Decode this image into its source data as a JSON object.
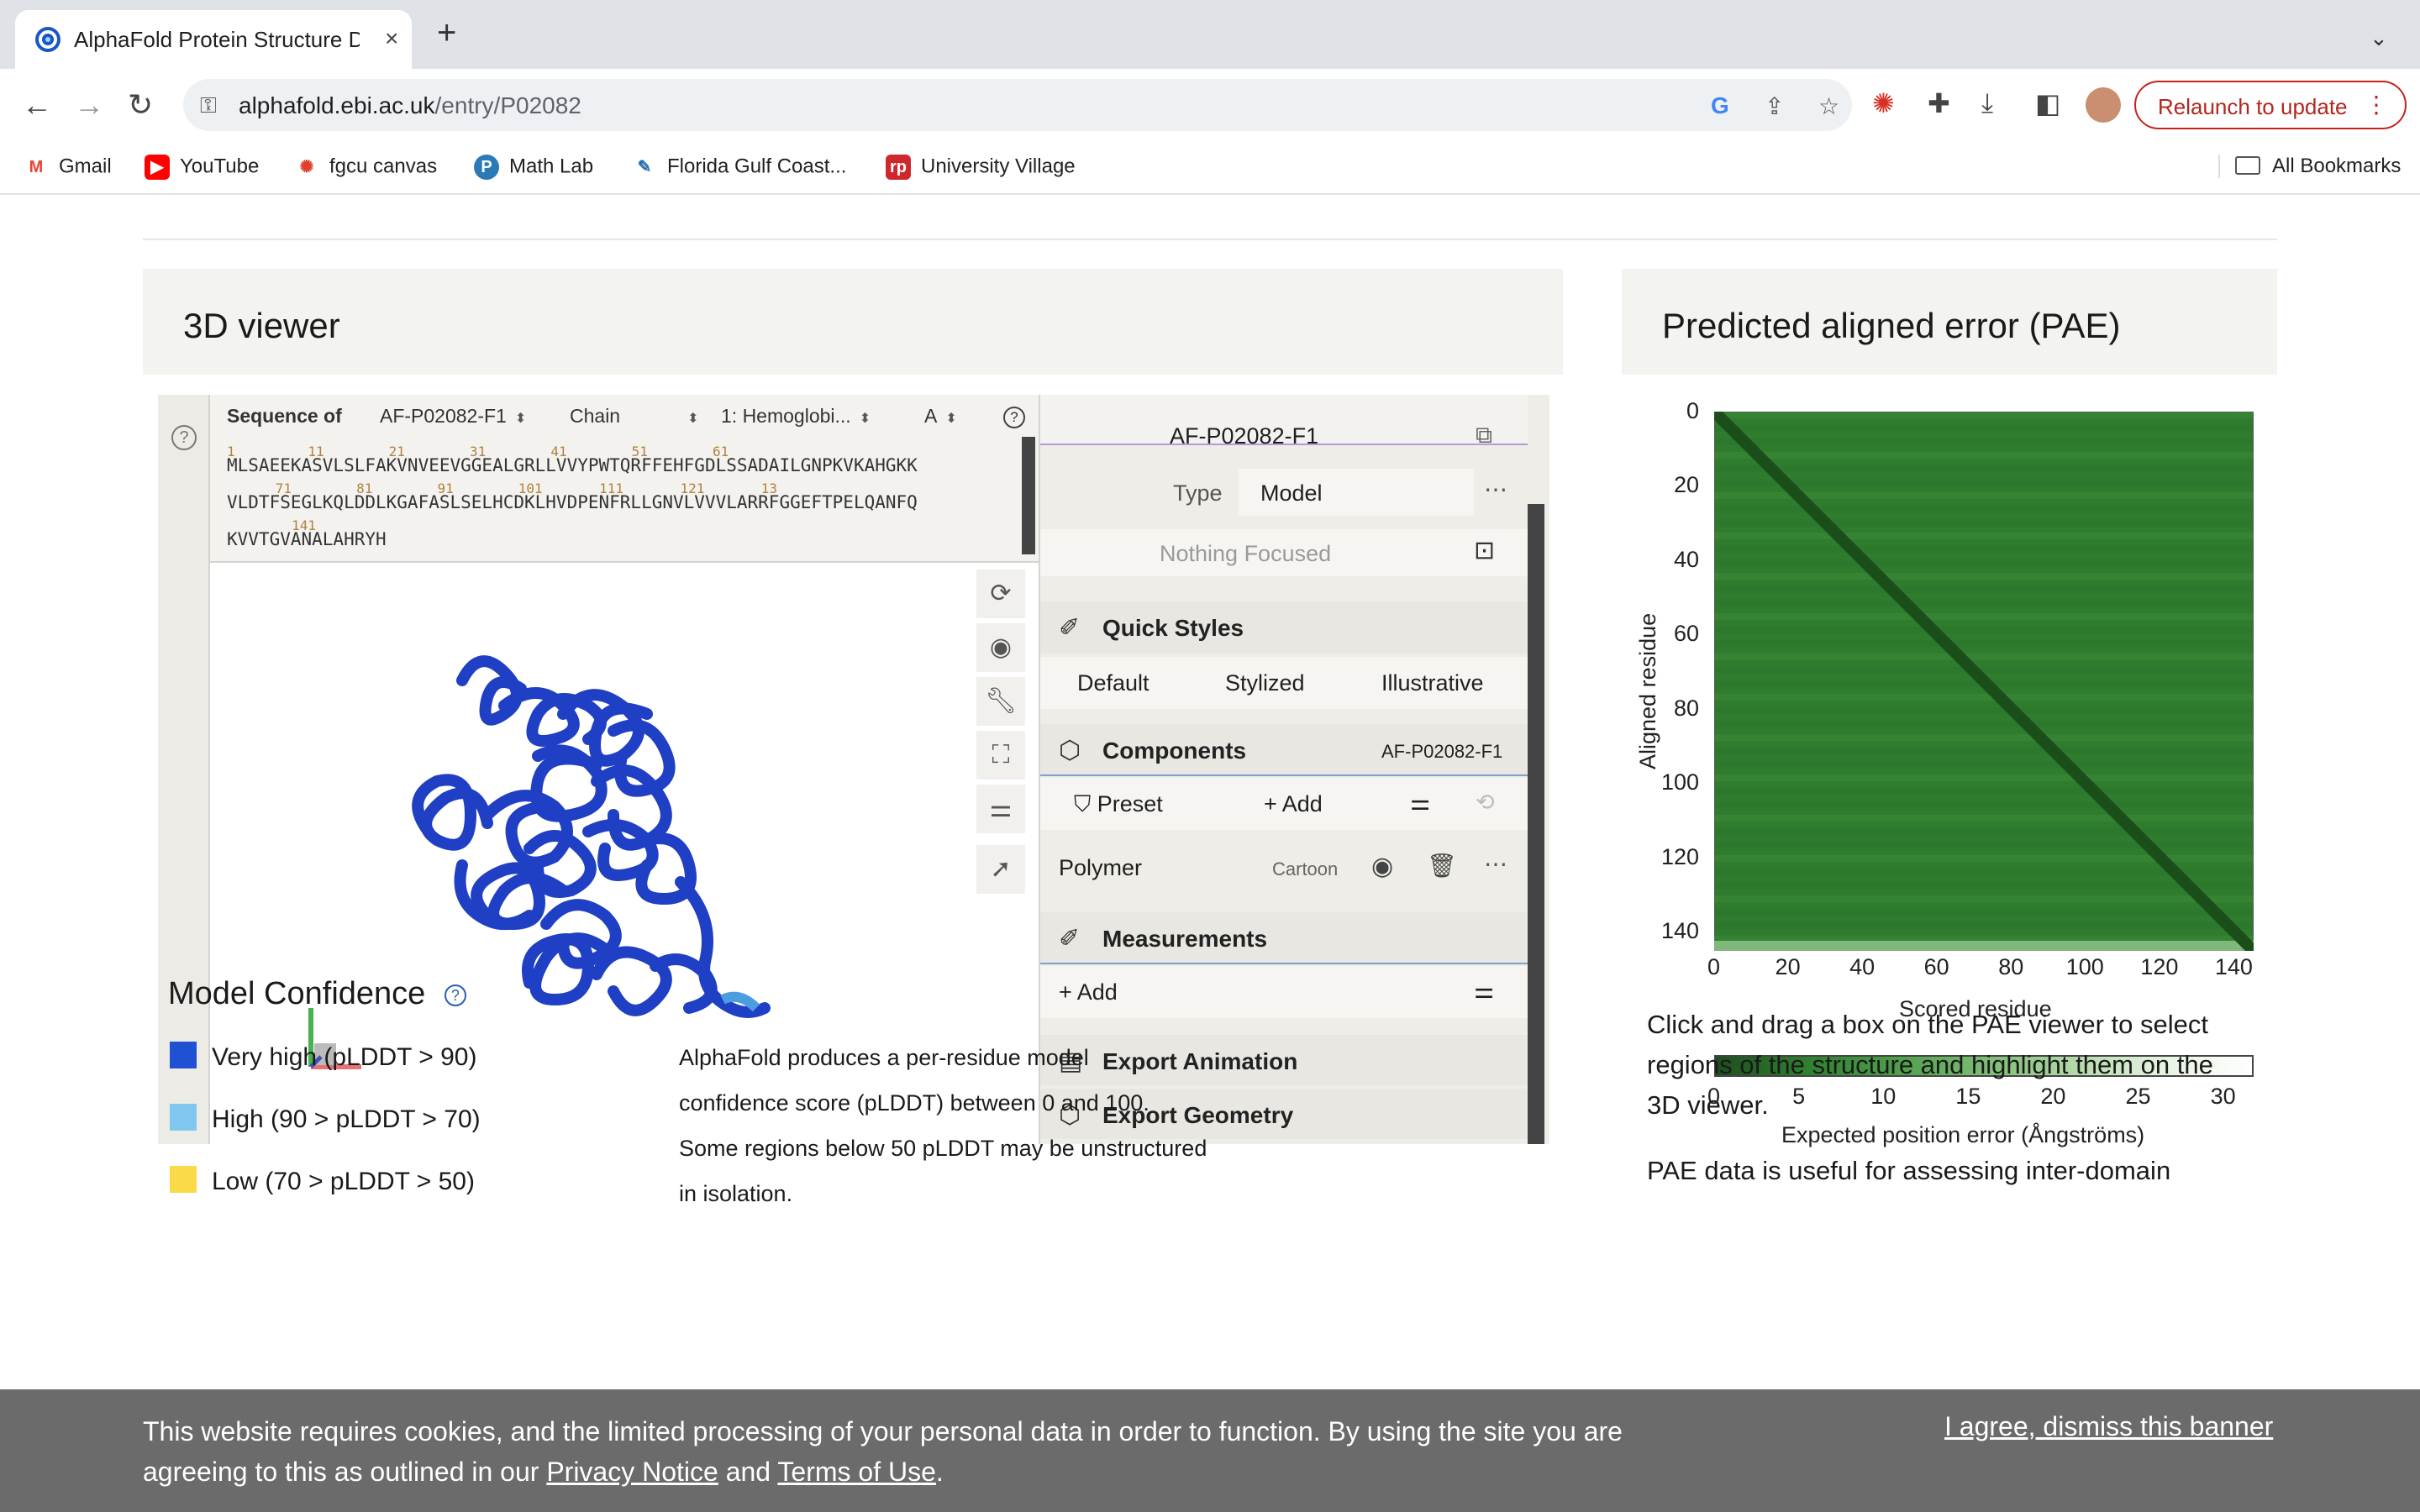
{
  "browser": {
    "tab_title": "AlphaFold Protein Structure D",
    "tab_close": "×",
    "new_tab": "+",
    "url_host": "alphafold.ebi.ac.uk",
    "url_path": "/entry/P02082",
    "relaunch_label": "Relaunch to update",
    "bookmarks": [
      "Gmail",
      "YouTube",
      "fgcu canvas",
      "Math Lab",
      "Florida Gulf Coast...",
      "University Village"
    ],
    "all_bookmarks": "All Bookmarks"
  },
  "viewer_panel": {
    "title": "3D viewer",
    "sequence": {
      "label": "Sequence of",
      "entry": "AF-P02082-F1",
      "chain_label": "Chain",
      "molecule": "1: Hemoglobi...",
      "chain_id": "A",
      "nums_line1": "1         11        21        31        41        51        61",
      "line1": "MLSAEEKASVLSLFAKVNVEEVGGEALGRLLVVYPWTQRFFEHFGDLSSADAILGNPKVKAHGKK",
      "nums_line2": "      71        81        91        101       111       121       13",
      "line2": "VLDTFSEGLKQLDDLKGAFASLSELHCDKLHVDPENFRLLGNVLVVVLARRFGGEFTPELQANFQ",
      "nums_line3": "        141",
      "line3": "KVVTGVANALAHRYH"
    },
    "structure": {
      "entry": "AF-P02082-F1",
      "type_label": "Type",
      "type_value": "Model",
      "focus": "Nothing Focused"
    },
    "quick_styles": {
      "title": "Quick Styles",
      "options": [
        "Default",
        "Stylized",
        "Illustrative"
      ]
    },
    "components": {
      "title": "Components",
      "entry": "AF-P02082-F1",
      "preset": "Preset",
      "add": "Add",
      "polymer": "Polymer",
      "representation": "Cartoon"
    },
    "measurements": {
      "title": "Measurements",
      "add": "Add"
    },
    "export_animation": "Export Animation",
    "export_geometry": "Export Geometry"
  },
  "pae_panel": {
    "title": "Predicted aligned error (PAE)",
    "y_ticks": [
      "0",
      "20",
      "40",
      "60",
      "80",
      "100",
      "120",
      "140"
    ],
    "x_ticks": [
      "0",
      "20",
      "40",
      "60",
      "80",
      "100",
      "120",
      "140"
    ],
    "ylabel": "Aligned residue",
    "xlabel": "Scored residue",
    "colorbar_ticks": [
      "0",
      "5",
      "10",
      "15",
      "20",
      "25",
      "30"
    ],
    "colorbar_label": "Expected position error (Ångströms)",
    "text1": "Click and drag a box on the PAE viewer to select regions of the structure and highlight them on the 3D viewer.",
    "text2": "PAE data is useful for assessing inter-domain"
  },
  "confidence": {
    "title": "Model Confidence",
    "items": [
      {
        "label": "Very high (pLDDT > 90)",
        "color": "#1f52d3"
      },
      {
        "label": "High (90 > pLDDT > 70)",
        "color": "#80c8ef"
      },
      {
        "label": "Low (70 > pLDDT > 50)",
        "color": "#fadb47"
      }
    ],
    "description": [
      "AlphaFold produces a per-residue model",
      "confidence score (pLDDT) between 0 and 100.",
      "Some regions below 50 pLDDT may be unstructured",
      "in isolation."
    ]
  },
  "cookie_banner": {
    "text_before": "This website requires cookies, and the limited processing of your personal data in order to function. By using the site you are agreeing to this as outlined in our ",
    "privacy": "Privacy Notice",
    "and": " and ",
    "terms": "Terms of Use",
    "end": ".",
    "agree": "I agree, dismiss this banner"
  },
  "colors": {
    "protein": "#1f3fc4",
    "pae_dark": "#1e5a1e",
    "pae_mid": "#3a8a36"
  }
}
